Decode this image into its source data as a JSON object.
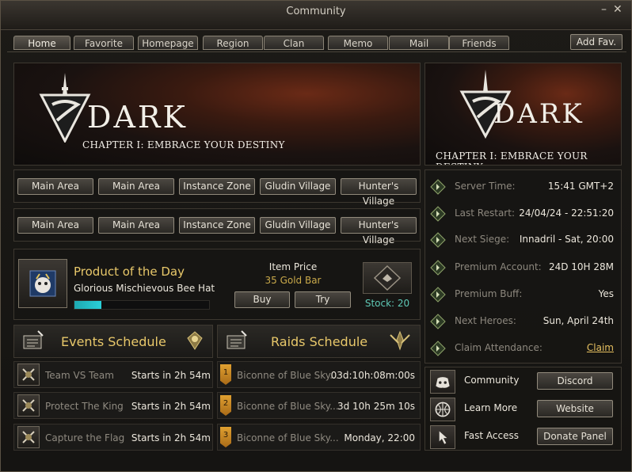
{
  "window": {
    "title": "Community"
  },
  "tabs": [
    "Home",
    "Favorite",
    "Homepage",
    "Region",
    "Clan",
    "Memo",
    "Mail",
    "Friends"
  ],
  "add_fav": "Add Fav.",
  "banner": {
    "logo": "DARK",
    "subtitle": "CHAPTER I: EMBRACE YOUR DESTINY"
  },
  "nav_row1": [
    "Main Area",
    "Main Area",
    "Instance Zone",
    "Gludin Village",
    "Hunter's Village"
  ],
  "nav_row2": [
    "Main Area",
    "Main Area",
    "Instance Zone",
    "Gludin Village",
    "Hunter's Village"
  ],
  "product": {
    "heading": "Product of the Day",
    "name": "Glorious Mischievous Bee Hat",
    "price_label": "Item Price",
    "price": "35 Gold Bar",
    "buy": "Buy",
    "try": "Try",
    "stock": "Stock: 20",
    "progress": 0.2
  },
  "info": [
    {
      "key": "Server Time:",
      "value": "15:41 GMT+2"
    },
    {
      "key": "Last Restart:",
      "value": "24/04/24 - 22:51:20"
    },
    {
      "key": "Next Siege:",
      "value": "Innadril - Sat, 20:00"
    },
    {
      "key": "Premium Account:",
      "value": "24D 10H 28M"
    },
    {
      "key": "Premium Buff:",
      "value": "Yes"
    },
    {
      "key": "Next Heroes:",
      "value": "Sun, April 24th"
    },
    {
      "key": "Claim Attendance:",
      "value": "Claim"
    }
  ],
  "events": {
    "title": "Events Schedule",
    "rows": [
      {
        "name": "Team VS Team",
        "time": "Starts in 2h 54m",
        "icon": "crossed-swords-icon"
      },
      {
        "name": "Protect The King",
        "time": "Starts in 2h 54m",
        "icon": "king-icon"
      },
      {
        "name": "Capture the Flag",
        "time": "Starts in 2h 54m",
        "icon": "flag-icon"
      }
    ]
  },
  "raids": {
    "title": "Raids Schedule",
    "rows": [
      {
        "rank": "1",
        "name": "Biconne of Blue Sky...",
        "time": "03d:10h:08m:00s"
      },
      {
        "rank": "2",
        "name": "Biconne of Blue Sky...",
        "time": "3d 10h 25m 10s"
      },
      {
        "rank": "3",
        "name": "Biconne of Blue Sky...",
        "time": "Monday, 22:00"
      }
    ]
  },
  "links": [
    {
      "label": "Community",
      "button": "Discord",
      "icon": "discord-icon"
    },
    {
      "label": "Learn More",
      "button": "Website",
      "icon": "globe-icon"
    },
    {
      "label": "Fast Access",
      "button": "Donate Panel",
      "icon": "pointer-icon"
    }
  ],
  "colors": {
    "accent": "#e8c86a",
    "link": "#e6c060",
    "progress": "#2ad0d8"
  }
}
